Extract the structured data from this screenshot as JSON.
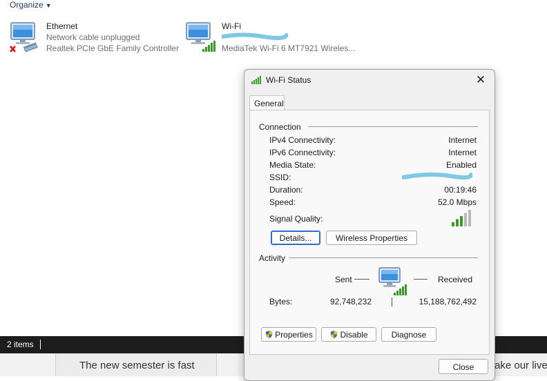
{
  "toolbar": {
    "organize_label": "Organize"
  },
  "adapters": [
    {
      "name": "Ethernet",
      "status": "Network cable unplugged",
      "device": "Realtek PCIe GbE Family Controller"
    },
    {
      "name": "Wi-Fi",
      "status": "",
      "device": "MediaTek Wi-Fi 6 MT7921 Wireles..."
    }
  ],
  "statusbar": {
    "items_count": "2 items"
  },
  "background_page": {
    "card_text_left": "The new semester is fast",
    "card_text_right": "ake our lives"
  },
  "dialog": {
    "title": "Wi-Fi Status",
    "close_glyph": "✕",
    "tab_general": "General",
    "connection": {
      "group_label": "Connection",
      "rows": [
        {
          "label": "IPv4 Connectivity:",
          "value": "Internet"
        },
        {
          "label": "IPv6 Connectivity:",
          "value": "Internet"
        },
        {
          "label": "Media State:",
          "value": "Enabled"
        },
        {
          "label": "SSID:",
          "value": ""
        },
        {
          "label": "Duration:",
          "value": "00:19:46"
        },
        {
          "label": "Speed:",
          "value": "52.0 Mbps"
        }
      ],
      "signal_quality_label": "Signal Quality:",
      "signal_bars_lit": 3,
      "signal_bars_total": 5
    },
    "buttons": {
      "details": "Details...",
      "wireless_properties": "Wireless Properties"
    },
    "activity": {
      "group_label": "Activity",
      "sent_label": "Sent",
      "received_label": "Received",
      "bytes_label": "Bytes:",
      "bytes_sent": "92,748,232",
      "bytes_received": "15,188,762,492"
    },
    "bottom_buttons": {
      "properties": "Properties",
      "disable": "Disable",
      "diagnose": "Diagnose",
      "close": "Close"
    }
  },
  "colors": {
    "accent": "#2f6cc5",
    "signal_green": "#3a9a2a",
    "status_bar": "#1d1d1d",
    "redaction": "#7ec8e3"
  }
}
